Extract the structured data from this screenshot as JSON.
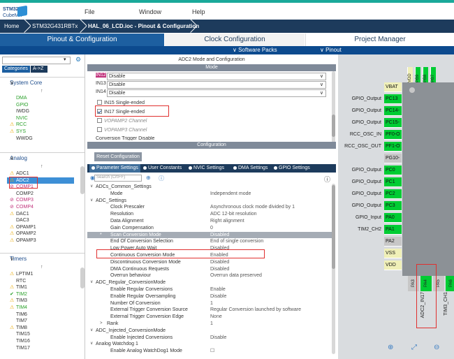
{
  "app": {
    "brand_top": "STM32",
    "brand_bottom": "CubeMX"
  },
  "menu": {
    "file": "File",
    "window": "Window",
    "help": "Help"
  },
  "breadcrumb": {
    "home": "Home",
    "device": "STM32G431RBTx",
    "file": "HAL_06_LCD.ioc - Pinout & Configuration"
  },
  "main_tabs": {
    "pinout": "Pinout & Configuration",
    "clock": "Clock Configuration",
    "project": "Project Manager"
  },
  "sub_tabs": {
    "software_packs": "∨ Software Packs",
    "pinout": "∨ Pinout"
  },
  "left": {
    "categories_tab": "Categories",
    "az_tab": "A->Z",
    "system_core": {
      "title": "System Core",
      "items": [
        {
          "label": "DMA",
          "icon": "",
          "color": "#2aa12a"
        },
        {
          "label": "GPIO",
          "icon": "",
          "color": "#2aa12a"
        },
        {
          "label": "IWDG",
          "icon": "",
          "color": "#333333"
        },
        {
          "label": "NVIC",
          "icon": "",
          "color": "#2aa12a"
        },
        {
          "label": "RCC",
          "icon": "⚠",
          "color": "#2aa12a"
        },
        {
          "label": "SYS",
          "icon": "⚠",
          "color": "#2aa12a"
        },
        {
          "label": "WWDG",
          "icon": "",
          "color": "#333333"
        }
      ]
    },
    "analog": {
      "title": "Analog",
      "items": [
        {
          "label": "ADC1",
          "icon": "⚠",
          "color": "#333333"
        },
        {
          "label": "ADC2",
          "icon": "⚠",
          "color": "#ffffff"
        },
        {
          "label": "COMP1",
          "icon": "⊘",
          "color": "#c0307a"
        },
        {
          "label": "COMP2",
          "icon": "",
          "color": "#333333"
        },
        {
          "label": "COMP3",
          "icon": "⊘",
          "color": "#c0307a"
        },
        {
          "label": "COMP4",
          "icon": "⊘",
          "color": "#c0307a"
        },
        {
          "label": "DAC1",
          "icon": "⚠",
          "color": "#333333"
        },
        {
          "label": "DAC3",
          "icon": "",
          "color": "#333333"
        },
        {
          "label": "OPAMP1",
          "icon": "⚠",
          "color": "#333333"
        },
        {
          "label": "OPAMP2",
          "icon": "⚠",
          "color": "#333333"
        },
        {
          "label": "OPAMP3",
          "icon": "⚠",
          "color": "#333333"
        }
      ]
    },
    "timers": {
      "title": "Timers",
      "items": [
        {
          "label": "LPTIM1",
          "icon": "⚠",
          "color": "#333333"
        },
        {
          "label": "RTC",
          "icon": "",
          "color": "#333333"
        },
        {
          "label": "TIM1",
          "icon": "⚠",
          "color": "#333333"
        },
        {
          "label": "TIM2",
          "icon": "✔",
          "color": "#2aa12a"
        },
        {
          "label": "TIM3",
          "icon": "⚠",
          "color": "#333333"
        },
        {
          "label": "TIM4",
          "icon": "⚠",
          "color": "#2aa12a"
        },
        {
          "label": "TIM6",
          "icon": "",
          "color": "#333333"
        },
        {
          "label": "TIM7",
          "icon": "",
          "color": "#333333"
        },
        {
          "label": "TIM8",
          "icon": "⚠",
          "color": "#333333"
        },
        {
          "label": "TIM15",
          "icon": "",
          "color": "#333333"
        },
        {
          "label": "TIM16",
          "icon": "",
          "color": "#333333"
        },
        {
          "label": "TIM17",
          "icon": "",
          "color": "#333333"
        }
      ]
    }
  },
  "mid": {
    "title": "ADC2 Mode and Configuration",
    "mode_header": "Mode",
    "mode_rows": [
      {
        "label": "IN12",
        "value": "Disable"
      },
      {
        "label": "IN13",
        "value": "Disable"
      },
      {
        "label": "IN14",
        "value": "Disable"
      }
    ],
    "checks": [
      {
        "label": "IN15 Single-ended",
        "checked": false,
        "disabled": false
      },
      {
        "label": "IN17 Single-ended",
        "checked": true,
        "disabled": false
      },
      {
        "label": "VOPAMP2 Channel",
        "checked": false,
        "disabled": true
      },
      {
        "label": "VOPAMP3 Channel",
        "checked": false,
        "disabled": true
      }
    ],
    "cut_row": "Conversion Trigger Disable",
    "config_header": "Configuration",
    "reset_button": "Reset Configuration",
    "cfg_tabs": [
      "Parameter Settings",
      "User Constants",
      "NVIC Settings",
      "DMA Settings",
      "GPIO Settings"
    ],
    "search_placeholder": "Search (Crtl+F)",
    "tree": [
      {
        "k": "ADCs_Common_Settings",
        "v": "",
        "level": 0,
        "toggle": "∨"
      },
      {
        "k": "Mode",
        "v": "Independent mode",
        "level": 2
      },
      {
        "k": "ADC_Settings",
        "v": "",
        "level": 0,
        "toggle": "∨"
      },
      {
        "k": "Clock Prescaler",
        "v": "Asynchronous clock mode divided by 1",
        "level": 2
      },
      {
        "k": "Resolution",
        "v": "ADC 12-bit resolution",
        "level": 2
      },
      {
        "k": "Data Alignment",
        "v": "Right alignment",
        "level": 2
      },
      {
        "k": "Gain Compensation",
        "v": "0",
        "level": 2
      },
      {
        "k": "Scan Conversion Mode",
        "v": "Disabled",
        "level": 2,
        "sel": true
      },
      {
        "k": "End Of Conversion Selection",
        "v": "End of single conversion",
        "level": 2
      },
      {
        "k": "Low Power Auto Wait",
        "v": "Disabled",
        "level": 2
      },
      {
        "k": "Continuous Conversion Mode",
        "v": "Enabled",
        "level": 2
      },
      {
        "k": "Discontinuous Conversion Mode",
        "v": "Disabled",
        "level": 2
      },
      {
        "k": "DMA Continuous Requests",
        "v": "Disabled",
        "level": 2
      },
      {
        "k": "Overrun behaviour",
        "v": "Overrun data preserved",
        "level": 2
      },
      {
        "k": "ADC_Regular_ConversionMode",
        "v": "",
        "level": 0,
        "toggle": "∨"
      },
      {
        "k": "Enable Regular Conversions",
        "v": "Enable",
        "level": 2
      },
      {
        "k": "Enable Regular Oversampling",
        "v": "Disable",
        "level": 2
      },
      {
        "k": "Number Of Conversion",
        "v": "1",
        "level": 2
      },
      {
        "k": "External Trigger Conversion Source",
        "v": "Regular Conversion launched by software",
        "level": 2
      },
      {
        "k": "External Trigger Conversion Edge",
        "v": "None",
        "level": 2
      },
      {
        "k": "Rank",
        "v": "1",
        "level": 3,
        "toggle": ">"
      },
      {
        "k": "ADC_Injected_ConversionMode",
        "v": "",
        "level": 0,
        "toggle": "∨"
      },
      {
        "k": "Enable Injected Conversions",
        "v": "Disable",
        "level": 2
      },
      {
        "k": "Analog Watchdog 1",
        "v": "",
        "level": 0,
        "toggle": "∨"
      },
      {
        "k": "Enable Analog WatchDog1 Mode",
        "v": "☐",
        "level": 2
      }
    ]
  },
  "chip": {
    "top_pins": [
      "VDD",
      "PB9",
      "PB8",
      "PB7"
    ],
    "left_pins": [
      {
        "pin": "VBAT",
        "label": "",
        "kind": "yellow"
      },
      {
        "pin": "PC13",
        "label": "GPIO_Output",
        "kind": "green"
      },
      {
        "pin": "PC14-",
        "label": "GPIO_Output",
        "kind": "green"
      },
      {
        "pin": "PC15-",
        "label": "GPIO_Output",
        "kind": "green"
      },
      {
        "pin": "PF0-O",
        "label": "RCC_OSC_IN",
        "kind": "green"
      },
      {
        "pin": "PF1-O",
        "label": "RCC_OSC_OUT",
        "kind": "green"
      },
      {
        "pin": "PG10-",
        "label": "",
        "kind": "gray"
      },
      {
        "pin": "PC0",
        "label": "GPIO_Output",
        "kind": "green"
      },
      {
        "pin": "PC1",
        "label": "GPIO_Output",
        "kind": "green"
      },
      {
        "pin": "PC2",
        "label": "GPIO_Output",
        "kind": "green"
      },
      {
        "pin": "PC3",
        "label": "GPIO_Output",
        "kind": "green"
      },
      {
        "pin": "PA0",
        "label": "GPIO_Input",
        "kind": "green"
      },
      {
        "pin": "PA1",
        "label": "TIM2_CH2",
        "kind": "green"
      },
      {
        "pin": "PA2",
        "label": "",
        "kind": "gray"
      },
      {
        "pin": "VSS",
        "label": "",
        "kind": "yellow"
      },
      {
        "pin": "VDD",
        "label": "",
        "kind": "yellow"
      }
    ],
    "bottom_pins": [
      {
        "pin": "PA3",
        "kind": "gray"
      },
      {
        "pin": "PA4",
        "kind": "green"
      },
      {
        "pin": "PA5",
        "kind": "gray"
      },
      {
        "pin": "PA6",
        "kind": "green"
      }
    ],
    "bottom_labels": [
      "ADC2_IN17",
      "TIM3_CH1"
    ],
    "colors": {
      "green": "#00cc33",
      "gray": "#c7c7c7",
      "yellow": "#f0f0b8",
      "chip_body": "#8c9196",
      "highlight": "#e0302f"
    }
  },
  "zoom": {
    "in": "⊕",
    "fit": "⤢",
    "out": "⊖"
  }
}
